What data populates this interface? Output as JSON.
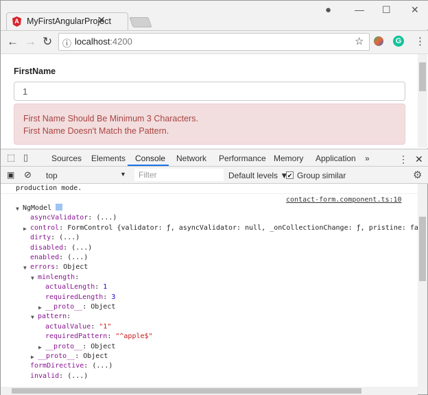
{
  "browser": {
    "tab_title": "MyFirstAngularProject",
    "tab_icon": "angular-icon",
    "url_host": "localhost",
    "url_port": ":4200"
  },
  "form": {
    "label": "FirstName",
    "value": "1",
    "errors": [
      "First Name Should Be Minimum 3 Characters.",
      "First Name Doesn't Match the Pattern."
    ],
    "error_color": "#a94442"
  },
  "devtools": {
    "tabs": [
      "Sources",
      "Elements",
      "Console",
      "Network",
      "Performance",
      "Memory",
      "Application"
    ],
    "active_tab": "Console",
    "more": "»",
    "context": "top",
    "filter_placeholder": "Filter",
    "levels": "Default levels ▼",
    "group_similar": "Group similar",
    "group_similar_checked": true
  },
  "console": {
    "prev_message": "production mode.",
    "source_link": "contact-form.component.ts:10",
    "lines": [
      {
        "indent": 0,
        "arrow": "down",
        "key": "NgModel",
        "value": "",
        "cls": "v",
        "plain": true
      },
      {
        "indent": 1,
        "arrow": "",
        "key": "asyncValidator",
        "value": "(...)",
        "cls": "v"
      },
      {
        "indent": 1,
        "arrow": "right",
        "key": "control",
        "value": "FormControl {validator: ƒ, asyncValidator: null, _onCollectionChange: ƒ, pristine: fals",
        "cls": "v"
      },
      {
        "indent": 1,
        "arrow": "",
        "key": "dirty",
        "value": "(...)",
        "cls": "v"
      },
      {
        "indent": 1,
        "arrow": "",
        "key": "disabled",
        "value": "(...)",
        "cls": "v"
      },
      {
        "indent": 1,
        "arrow": "",
        "key": "enabled",
        "value": "(...)",
        "cls": "v"
      },
      {
        "indent": 1,
        "arrow": "down",
        "key": "errors",
        "value": "Object",
        "cls": "v"
      },
      {
        "indent": 2,
        "arrow": "down",
        "key": "minlength",
        "value": "",
        "cls": "v"
      },
      {
        "indent": 3,
        "arrow": "",
        "key": "actualLength",
        "value": "1",
        "cls": "n"
      },
      {
        "indent": 3,
        "arrow": "",
        "key": "requiredLength",
        "value": "3",
        "cls": "n"
      },
      {
        "indent": 3,
        "arrow": "right",
        "key": "__proto__",
        "value": "Object",
        "cls": "v"
      },
      {
        "indent": 2,
        "arrow": "down",
        "key": "pattern",
        "value": "",
        "cls": "v"
      },
      {
        "indent": 3,
        "arrow": "",
        "key": "actualValue",
        "value": "\"1\"",
        "cls": "s"
      },
      {
        "indent": 3,
        "arrow": "",
        "key": "requiredPattern",
        "value": "\"^apple$\"",
        "cls": "s"
      },
      {
        "indent": 3,
        "arrow": "right",
        "key": "__proto__",
        "value": "Object",
        "cls": "v"
      },
      {
        "indent": 2,
        "arrow": "right",
        "key": "__proto__",
        "value": "Object",
        "cls": "v"
      },
      {
        "indent": 1,
        "arrow": "",
        "key": "formDirective",
        "value": "(...)",
        "cls": "v"
      },
      {
        "indent": 1,
        "arrow": "",
        "key": "invalid",
        "value": "(...)",
        "cls": "v"
      }
    ]
  }
}
